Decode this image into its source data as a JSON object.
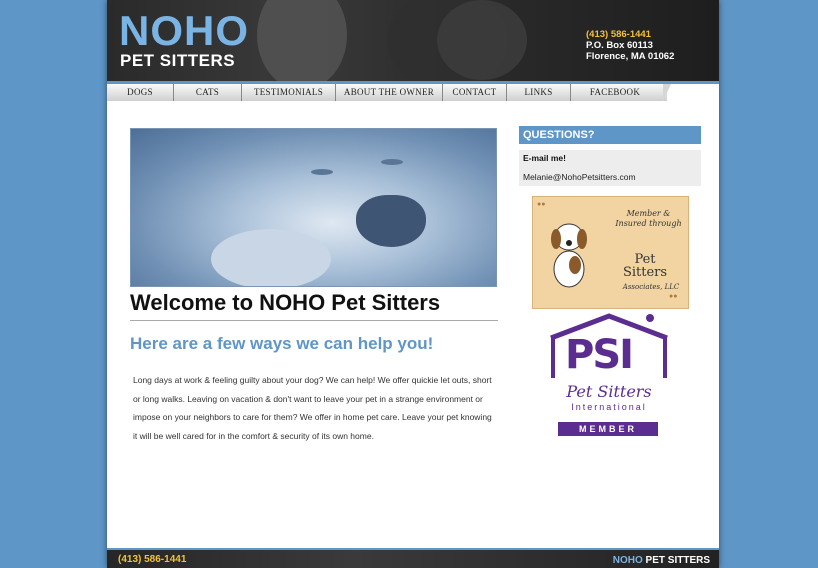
{
  "header": {
    "logo_main": "NOHO",
    "logo_sub": "PET SITTERS",
    "phone": "(413) 586-1441",
    "po_box": "P.O. Box 60113",
    "city": "Florence, MA 01062"
  },
  "nav": {
    "items": [
      "DOGS",
      "CATS",
      "TESTIMONIALS",
      "ABOUT THE OWNER",
      "CONTACT",
      "LINKS",
      "FACEBOOK"
    ]
  },
  "main": {
    "title": "Welcome to NOHO Pet Sitters",
    "subtitle": "Here are a few ways we can help you!",
    "intro": "Long days at work & feeling guilty about your dog? We can help! We offer quickie let outs, short or long walks. Leaving on vacation & don't want to leave your pet in a strange environment or impose on your neighbors to care for them? We offer in home pet care. Leave your pet knowing it will be well cared for in the comfort & security of its own home."
  },
  "sidebar": {
    "heading": "QUESTIONS?",
    "email_label": "E-mail me!",
    "email": "Melanie@NohoPetsitters.com",
    "psa_badge": {
      "line1": "Member &",
      "line2": "Insured through",
      "name1": "Pet",
      "name2": "Sitters",
      "suffix": "Associates, LLC"
    },
    "psi_badge": {
      "letters": "PSI",
      "name": "Pet Sitters",
      "intl": "International",
      "member": "MEMBER"
    }
  },
  "footer": {
    "phone": "(413) 586-1441",
    "logo_main": "NOHO",
    "logo_sub": "PET SITTERS"
  },
  "colors": {
    "background": "#5e96c8",
    "accent": "#5e96c8",
    "phone": "#f2c23a",
    "psi_purple": "#5c2d91"
  }
}
